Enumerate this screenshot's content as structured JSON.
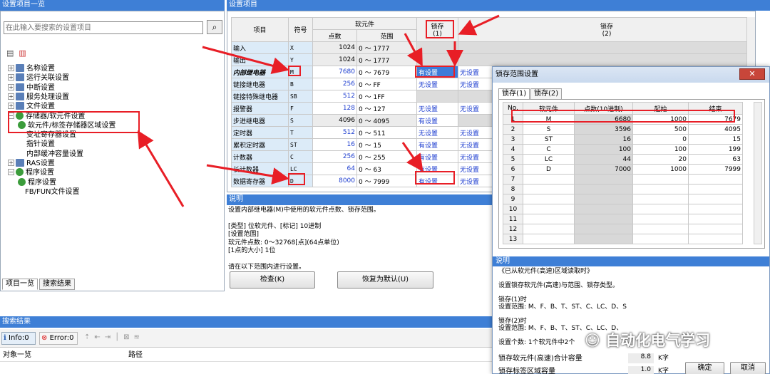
{
  "left": {
    "title": "设置项目一览",
    "search_placeholder": "在此输入要搜索的设置项目",
    "tree": [
      {
        "label": "名称设置",
        "icon": "table-icon"
      },
      {
        "label": "运行关联设置",
        "icon": "table-icon"
      },
      {
        "label": "中断设置",
        "icon": "table-icon"
      },
      {
        "label": "服务处理设置",
        "icon": "table-icon"
      },
      {
        "label": "文件设置",
        "icon": "table-icon"
      },
      {
        "label": "存储器/软元件设置",
        "icon": "check-icon"
      },
      {
        "label": "软元件/标签存储器区域设置",
        "icon": "check-icon"
      },
      {
        "label": "变址寄存器设置",
        "icon": ""
      },
      {
        "label": "指针设置",
        "icon": ""
      },
      {
        "label": "内部缓冲容量设置",
        "icon": ""
      },
      {
        "label": "RAS设置",
        "icon": "table-icon"
      },
      {
        "label": "程序设置",
        "icon": "check-icon"
      },
      {
        "label": "程序设置",
        "icon": "check-icon"
      },
      {
        "label": "FB/FUN文件设置",
        "icon": ""
      }
    ],
    "tabs": [
      "项目一览",
      "搜索结果"
    ]
  },
  "search": {
    "title": "搜索结果",
    "info": "Info:0",
    "error": "Error:0",
    "col_object": "对象一览",
    "col_path": "路径"
  },
  "settings": {
    "title": "设置项目",
    "headers": {
      "item": "项目",
      "symbol": "符号",
      "device": "软元件",
      "points": "点数",
      "range": "范围",
      "latch1": "锁存",
      "latch1_sub": "(1)",
      "latch2": "锁存",
      "latch2_sub": "(2)"
    },
    "rows": [
      {
        "item": "输入",
        "sym": "X",
        "pts": "1024",
        "range": "0 ～ 1777",
        "l1": "",
        "l2": ""
      },
      {
        "item": "输出",
        "sym": "Y",
        "pts": "1024",
        "range": "0 ～ 1777",
        "l1": "",
        "l2": ""
      },
      {
        "item": "内部继电器",
        "sym": "M",
        "pts": "7680",
        "range": "0 ～ 7679",
        "l1": "有设置",
        "l2": "无设置"
      },
      {
        "item": "链接继电器",
        "sym": "B",
        "pts": "256",
        "range": "0 ～ FF",
        "l1": "无设置",
        "l2": "无设置"
      },
      {
        "item": "链接特殊继电器",
        "sym": "SB",
        "pts": "512",
        "range": "0 ～ 1FF",
        "l1": "",
        "l2": ""
      },
      {
        "item": "报警器",
        "sym": "F",
        "pts": "128",
        "range": "0 ～ 127",
        "l1": "无设置",
        "l2": "无设置"
      },
      {
        "item": "步进继电器",
        "sym": "S",
        "pts": "4096",
        "range": "0 ～ 4095",
        "l1": "有设置",
        "l2": ""
      },
      {
        "item": "定时器",
        "sym": "T",
        "pts": "512",
        "range": "0 ～ 511",
        "l1": "无设置",
        "l2": "无设置"
      },
      {
        "item": "累积定时器",
        "sym": "ST",
        "pts": "16",
        "range": "0 ～ 15",
        "l1": "有设置",
        "l2": "无设置"
      },
      {
        "item": "计数器",
        "sym": "C",
        "pts": "256",
        "range": "0 ～ 255",
        "l1": "有设置",
        "l2": "无设置"
      },
      {
        "item": "长计数器",
        "sym": "LC",
        "pts": "64",
        "range": "0 ～ 63",
        "l1": "有设置",
        "l2": "无设置"
      },
      {
        "item": "数据寄存器",
        "sym": "D",
        "pts": "8000",
        "range": "0 ～ 7999",
        "l1": "有设置",
        "l2": "无设置"
      }
    ]
  },
  "explain": {
    "title": "说明",
    "lines": [
      "设置内部继电器(M)中使用的软元件点数、锁存范围。",
      "",
      "[类型] 位软元件、[标记] 10进制",
      "[设置范围]",
      "软元件点数: 0～32768[点](64点单位)",
      "[1点的大小] 1位",
      "",
      "请在以下范围内进行设置。"
    ],
    "check_btn": "检查(K)",
    "default_btn": "恢复为默认(U)"
  },
  "dialog": {
    "title": "锁存范围设置",
    "tabs": [
      "锁存(1)",
      "锁存(2)"
    ],
    "headers": [
      "No.",
      "软元件",
      "点数(10进制)",
      "起始",
      "结束"
    ],
    "rows": [
      [
        "1",
        "M",
        "6680",
        "1000",
        "7679"
      ],
      [
        "2",
        "S",
        "3596",
        "500",
        "4095"
      ],
      [
        "3",
        "ST",
        "16",
        "0",
        "15"
      ],
      [
        "4",
        "C",
        "100",
        "100",
        "199"
      ],
      [
        "5",
        "LC",
        "44",
        "20",
        "63"
      ],
      [
        "6",
        "D",
        "7000",
        "1000",
        "7999"
      ],
      [
        "7",
        "",
        "",
        "",
        ""
      ],
      [
        "8",
        "",
        "",
        "",
        ""
      ],
      [
        "9",
        "",
        "",
        "",
        ""
      ],
      [
        "10",
        "",
        "",
        "",
        ""
      ],
      [
        "11",
        "",
        "",
        "",
        ""
      ],
      [
        "12",
        "",
        "",
        "",
        ""
      ],
      [
        "13",
        "",
        "",
        "",
        ""
      ]
    ],
    "explain_title": "说明",
    "explain_lines": [
      "《已从软元件(高速)区域读取时》",
      "",
      "设置锁存软元件(高速)与范围、锁存类型。",
      "",
      "锁存(1)时",
      "设置范围: M、F、B、T、ST、C、LC、D、S",
      "",
      "锁存(2)时",
      "设置范围: M、F、B、T、ST、C、LC、D、",
      "",
      "设置个数: 1个软元件中2个"
    ],
    "total_label": "锁存软元件(高速)合计容量",
    "total_value": "8.8",
    "total_unit": "K字",
    "tag_label": "锁存标签区域容量",
    "tag_value": "1.0",
    "tag_unit": "K字",
    "ok": "确定",
    "cancel": "取消"
  },
  "watermark": "自动化电气学习"
}
